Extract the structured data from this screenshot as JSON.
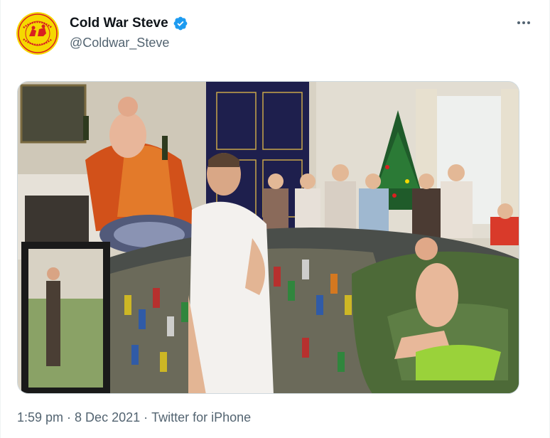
{
  "tweet": {
    "author": {
      "display_name": "Cold War Steve",
      "handle": "@Coldwar_Steve",
      "verified": true,
      "avatar_icon": "cold-war-steve-logo-icon"
    },
    "more_icon": "more-dots-icon",
    "media": {
      "image": "collage-photo"
    },
    "meta": {
      "time": "1:59 pm",
      "separator": "·",
      "date": "8 Dec 2021",
      "source": "Twitter for iPhone"
    }
  },
  "colors": {
    "text_primary": "#0f1419",
    "text_secondary": "#536471",
    "verified_blue": "#1d9bf0",
    "avatar_yellow": "#f5d800",
    "avatar_red": "#d92020"
  }
}
